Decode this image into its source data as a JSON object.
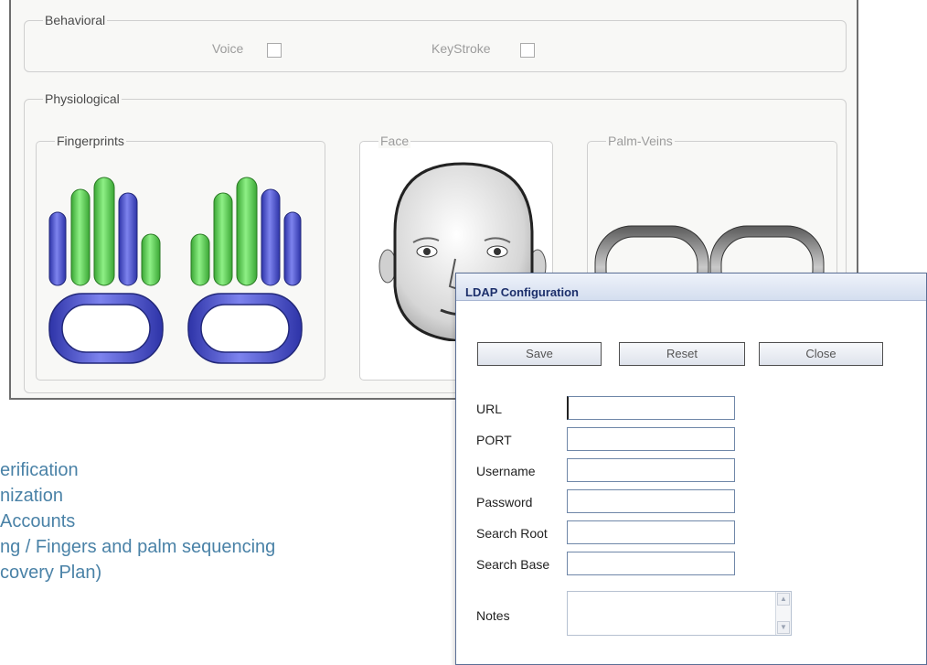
{
  "biometric_panel": {
    "behavioral": {
      "legend": "Behavioral",
      "voice_label": "Voice",
      "keystroke_label": "KeyStroke"
    },
    "physiological": {
      "legend": "Physiological",
      "fingerprints_legend": "Fingerprints",
      "face_legend": "Face",
      "palm_veins_legend": "Palm-Veins"
    },
    "colors": {
      "finger_blue": "#4f55c9",
      "finger_green": "#5fcf55",
      "palm_blue": "#5a60d0",
      "palm_gray": "#8a8a8a"
    }
  },
  "feature_list": [
    "erification",
    "nization",
    "Accounts",
    "ng / Fingers and palm sequencing",
    "covery Plan)"
  ],
  "ldap_dialog": {
    "title": "LDAP Configuration",
    "buttons": {
      "save": "Save",
      "reset": "Reset",
      "close": "Close"
    },
    "fields": {
      "url": {
        "label": "URL",
        "value": ""
      },
      "port": {
        "label": "PORT",
        "value": ""
      },
      "username": {
        "label": "Username",
        "value": ""
      },
      "password": {
        "label": "Password",
        "value": ""
      },
      "search_root": {
        "label": "Search Root",
        "value": ""
      },
      "search_base": {
        "label": "Search Base",
        "value": ""
      },
      "notes": {
        "label": "Notes",
        "value": ""
      }
    },
    "icons": {
      "scroll_up": "chevron-up-icon",
      "scroll_down": "chevron-down-icon"
    }
  }
}
